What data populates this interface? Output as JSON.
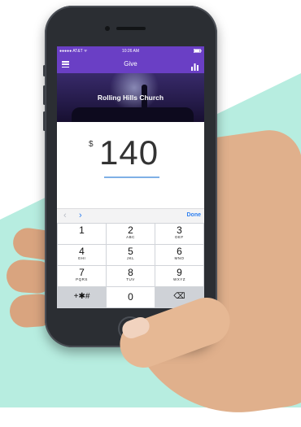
{
  "status_bar": {
    "carrier": "●●●●● AT&T ᯤ",
    "time": "10:26 AM"
  },
  "nav": {
    "title": "Give"
  },
  "hero": {
    "title": "Rolling Hills Church"
  },
  "amount": {
    "currency": "$",
    "value": "140"
  },
  "accessory": {
    "prev": "‹",
    "next": "›",
    "done": "Done"
  },
  "keypad": {
    "keys": [
      {
        "num": "1",
        "letters": ""
      },
      {
        "num": "2",
        "letters": "ABC"
      },
      {
        "num": "3",
        "letters": "DEF"
      },
      {
        "num": "4",
        "letters": "GHI"
      },
      {
        "num": "5",
        "letters": "JKL"
      },
      {
        "num": "6",
        "letters": "MNO"
      },
      {
        "num": "7",
        "letters": "PQRS"
      },
      {
        "num": "8",
        "letters": "TUV"
      },
      {
        "num": "9",
        "letters": "WXYZ"
      },
      {
        "num": "+✱#",
        "letters": ""
      },
      {
        "num": "0",
        "letters": ""
      },
      {
        "num": "⌫",
        "letters": ""
      }
    ]
  },
  "colors": {
    "brand_purple": "#6a3fc5",
    "accent_blue": "#2e7ff0",
    "mint": "#b7ede0"
  },
  "icons": {
    "menu": "hamburger-icon",
    "stats": "bar-chart-icon",
    "delete": "backspace-icon"
  }
}
